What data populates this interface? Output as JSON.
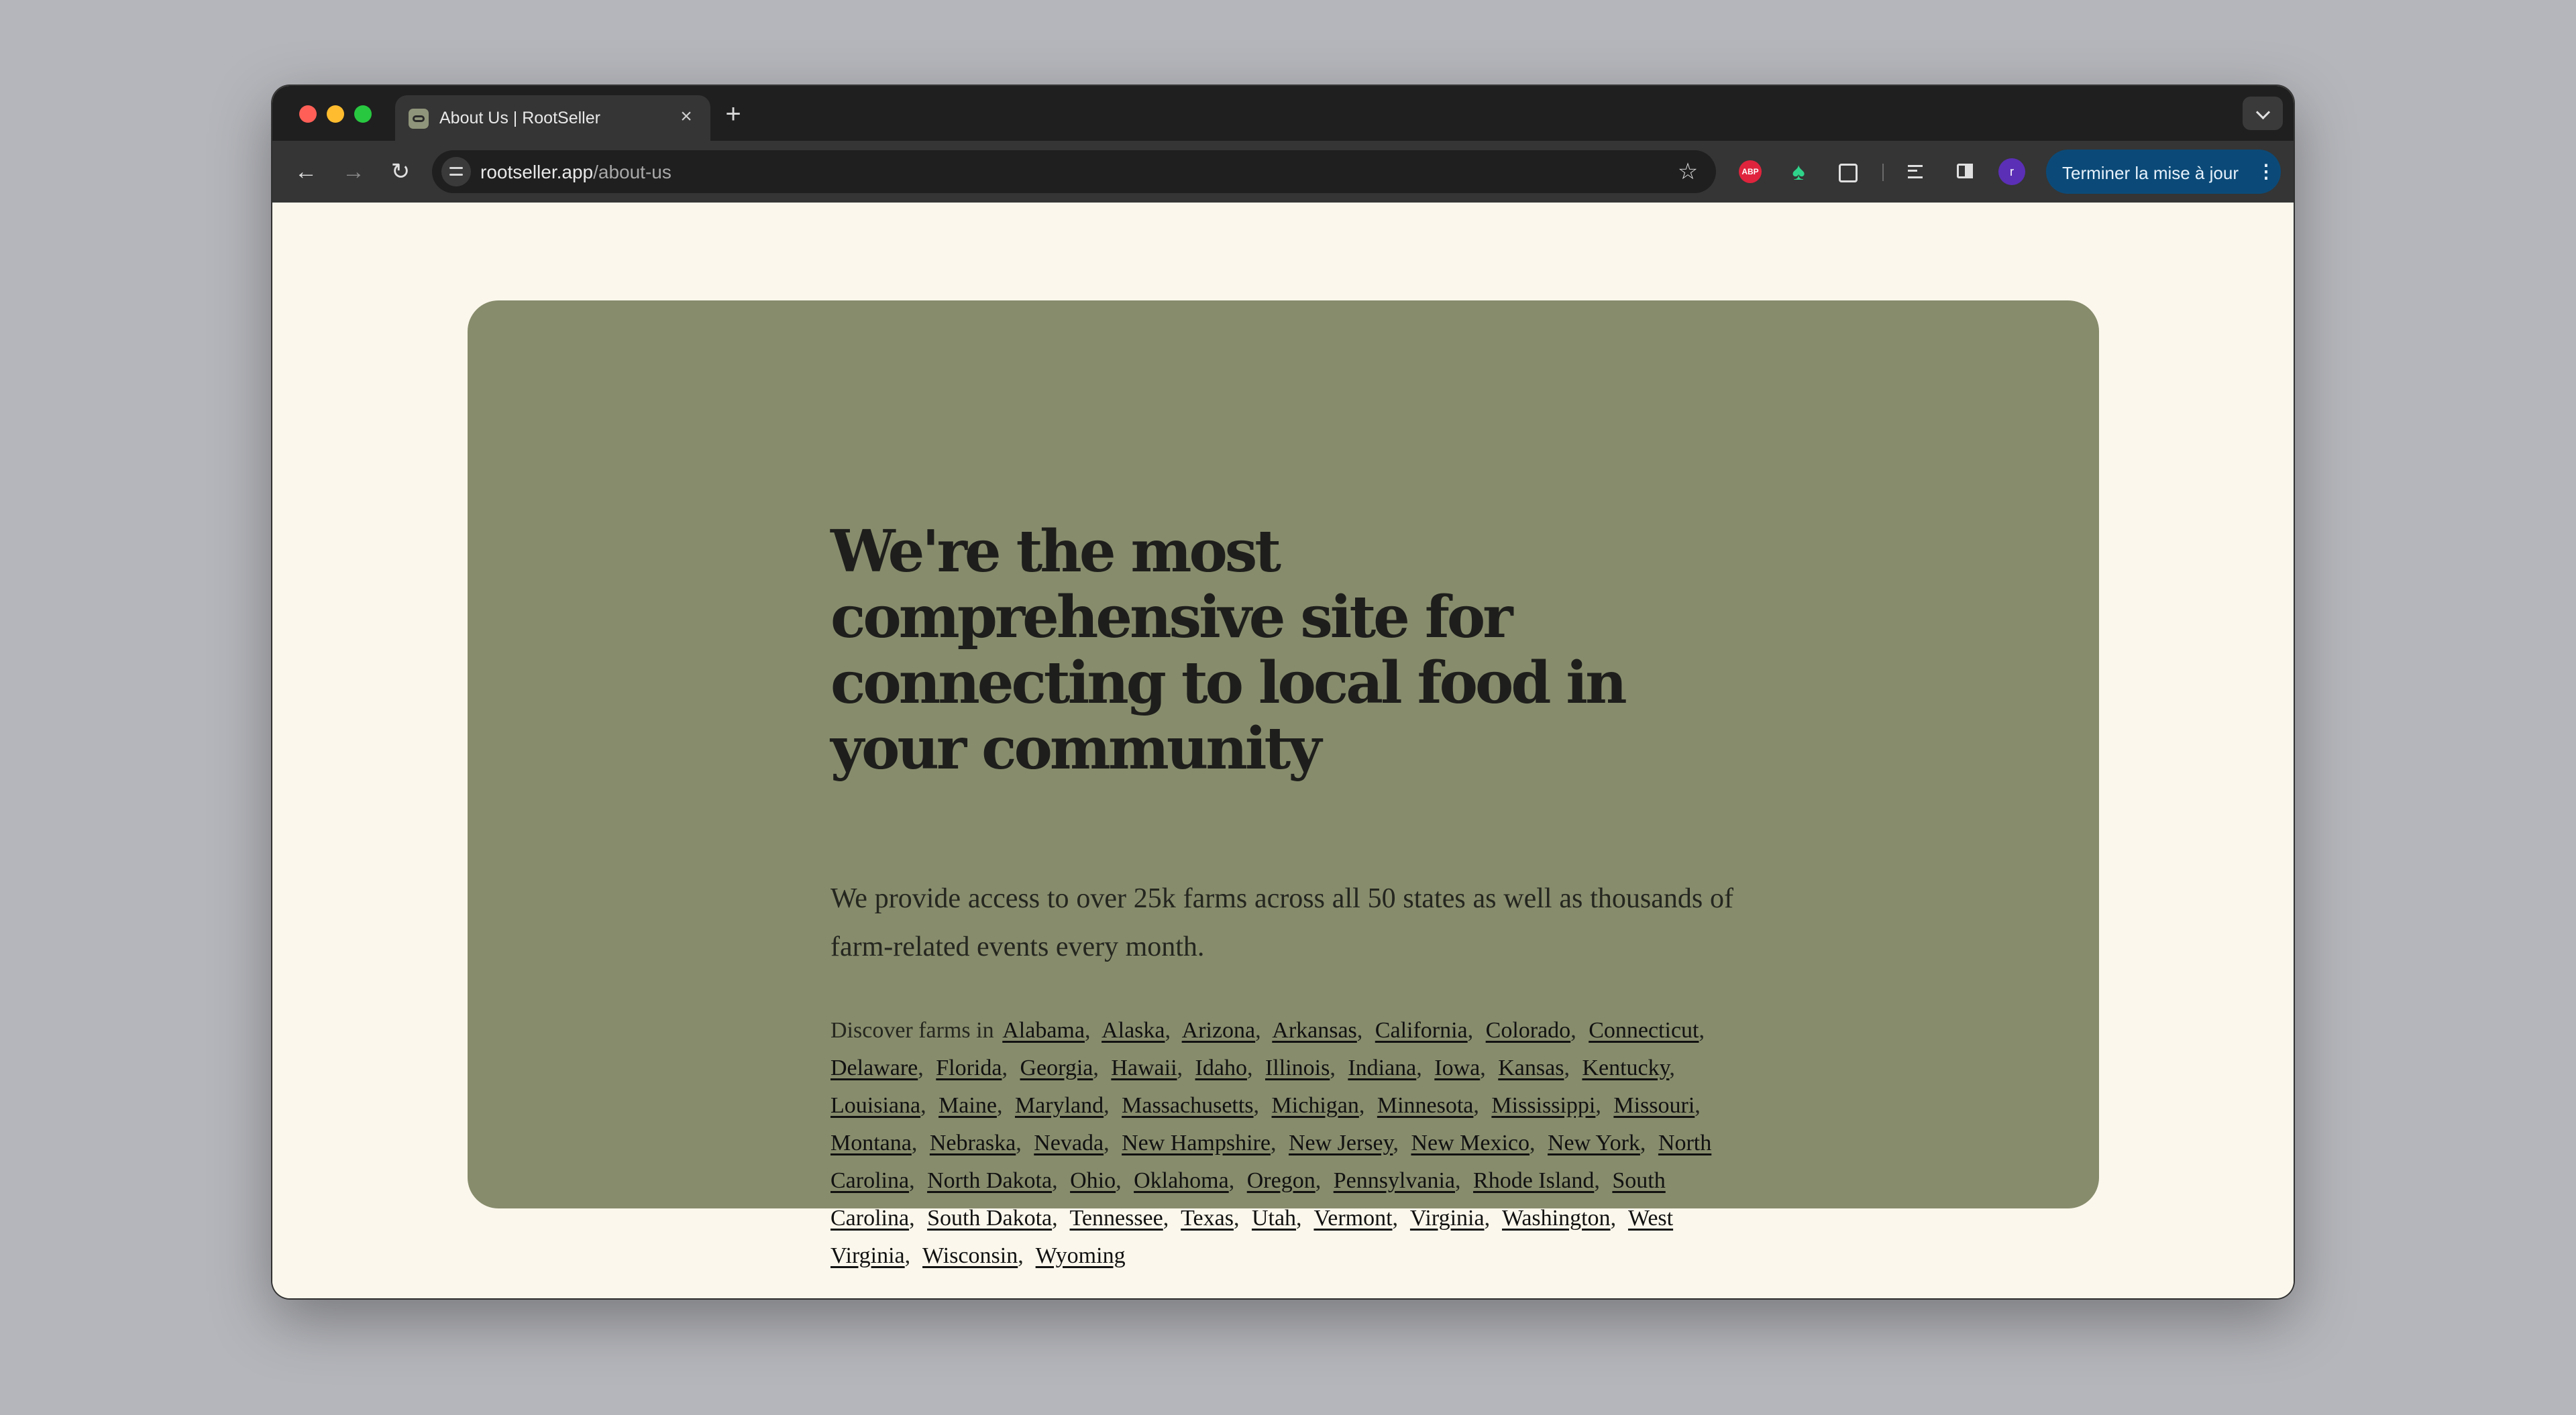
{
  "browser": {
    "tab_title": "About Us | RootSeller",
    "tab_close": "×",
    "new_tab": "+",
    "url_host": "rootseller.app",
    "url_path": "/about-us",
    "back": "←",
    "forward": "→",
    "reload": "↻",
    "star": "☆",
    "profile_initial": "r",
    "update_button": "Terminer la mise à jour",
    "menu": "⋮",
    "ext_tree": "♠"
  },
  "about": {
    "heading": "We're the most comprehensive site for connecting to local food in your community",
    "intro": "We provide access to over 25k farms across all 50 states as well as thousands of farm-related events every month.",
    "discover_label": "Discover farms in",
    "states": [
      "Alabama",
      "Alaska",
      "Arizona",
      "Arkansas",
      "California",
      "Colorado",
      "Connecticut",
      "Delaware",
      "Florida",
      "Georgia",
      "Hawaii",
      "Idaho",
      "Illinois",
      "Indiana",
      "Iowa",
      "Kansas",
      "Kentucky",
      "Louisiana",
      "Maine",
      "Maryland",
      "Massachusetts",
      "Michigan",
      "Minnesota",
      "Mississippi",
      "Missouri",
      "Montana",
      "Nebraska",
      "Nevada",
      "New Hampshire",
      "New Jersey",
      "New Mexico",
      "New York",
      "North Carolina",
      "North Dakota",
      "Ohio",
      "Oklahoma",
      "Oregon",
      "Pennsylvania",
      "Rhode Island",
      "South Carolina",
      "South Dakota",
      "Tennessee",
      "Texas",
      "Utah",
      "Vermont",
      "Virginia",
      "Washington",
      "West Virginia",
      "Wisconsin",
      "Wyoming"
    ]
  },
  "icons": {
    "favicon": "rootseller-favicon-icon",
    "chat": "chat-bubble-icon"
  }
}
